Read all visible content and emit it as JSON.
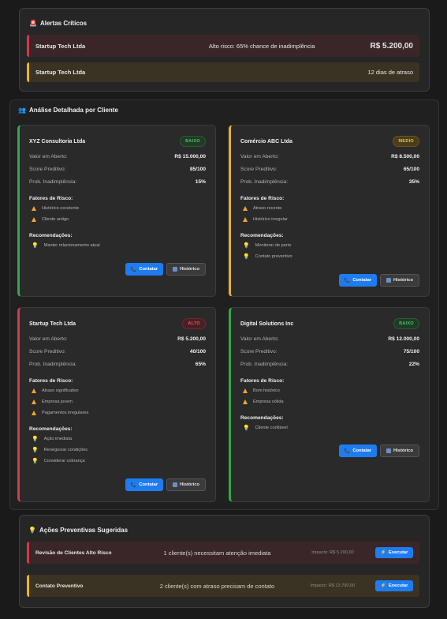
{
  "alerts": {
    "title": "Alertas Críticos",
    "icon": "siren-icon",
    "items": [
      {
        "client": "Startup Tech Ltda",
        "message": "Alto risco: 65% chance de inadimplência",
        "amount": "R$ 5.200,00",
        "level": "red"
      },
      {
        "client": "Startup Tech Ltda",
        "message": "",
        "late": "12 dias de atraso",
        "level": "yellow"
      }
    ]
  },
  "analysis": {
    "title": "Análise Detalhada por Cliente",
    "icon": "people-icon",
    "labels": {
      "open_value": "Valor em Aberto:",
      "score": "Score Preditivo:",
      "prob": "Prob. Inadimplência:",
      "risk_factors": "Fatores de Risco:",
      "recommendations": "Recomendações:",
      "contact_button": "Contatar",
      "history_button": "Histórico"
    },
    "clients": [
      {
        "name": "XYZ Consultoria Ltda",
        "badge": "BAIXO",
        "risk": "low",
        "open_value": "R$ 15.000,00",
        "score": "85/100",
        "prob": "15%",
        "factors": [
          "Histórico excelente",
          "Cliente antigo"
        ],
        "recommendations": [
          "Manter relacionamento atual"
        ]
      },
      {
        "name": "Comércio ABC Ltda",
        "badge": "MEDIO",
        "risk": "med",
        "open_value": "R$ 8.500,00",
        "score": "65/100",
        "prob": "35%",
        "factors": [
          "Atraso recente",
          "Histórico irregular"
        ],
        "recommendations": [
          "Monitorar de perto",
          "Contato preventivo"
        ]
      },
      {
        "name": "Startup Tech Ltda",
        "badge": "ALTO",
        "risk": "high",
        "open_value": "R$ 5.200,00",
        "score": "40/100",
        "prob": "65%",
        "factors": [
          "Atraso significativo",
          "Empresa jovem",
          "Pagamentos irregulares"
        ],
        "recommendations": [
          "Ação imediata",
          "Renegociar condições",
          "Considerar cobrança"
        ]
      },
      {
        "name": "Digital Solutions Inc",
        "badge": "BAIXO",
        "risk": "low",
        "open_value": "R$ 12.000,00",
        "score": "75/100",
        "prob": "22%",
        "factors": [
          "Bom histórico",
          "Empresa sólida"
        ],
        "recommendations": [
          "Cliente confiável"
        ]
      }
    ]
  },
  "actions": {
    "title": "Ações Preventivas Sugeridas",
    "icon": "lightbulb-icon",
    "execute_label": "Executar",
    "items": [
      {
        "title": "Revisão de Clientes Alto Risco",
        "description": "1 cliente(s) necessitam atenção imediata",
        "impact": "Impacto: R$ 5.200,00",
        "level": "red"
      },
      {
        "title": "Contato Preventivo",
        "description": "2 cliente(s) com atraso precisam de contato",
        "impact": "Impacto: R$ 13.700,00",
        "level": "yellow"
      }
    ]
  },
  "colors": {
    "background": "#1a1a1a",
    "panel": "#262626",
    "danger": "#d43a44",
    "warning": "#e7b42a",
    "success": "#35a74a",
    "primary": "#1e7cf2"
  }
}
